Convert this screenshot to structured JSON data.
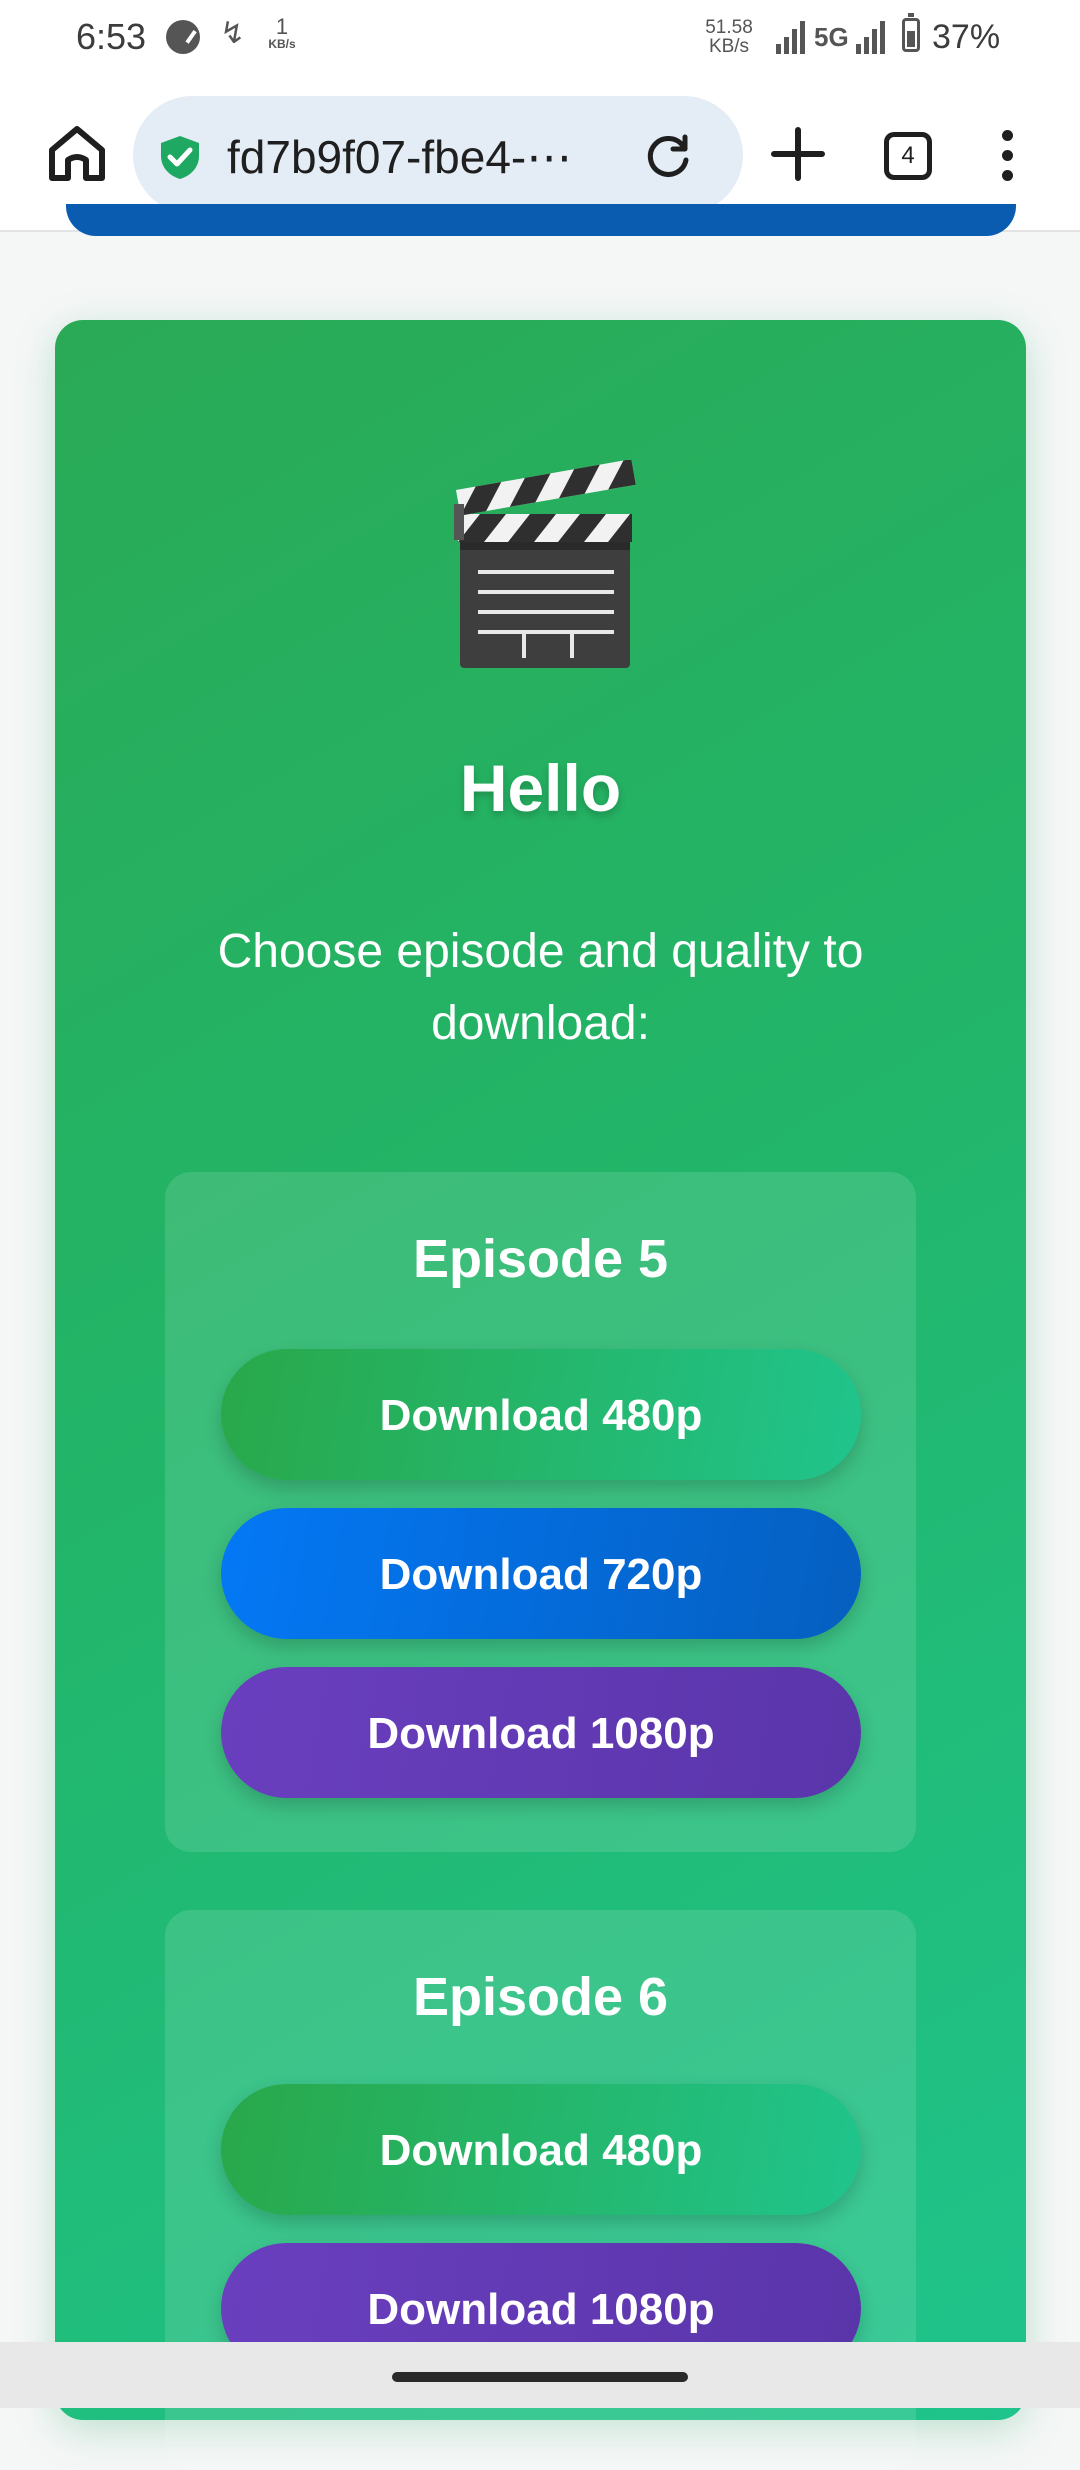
{
  "status_bar": {
    "time": "6:53",
    "speed_left_value": "1",
    "speed_left_unit": "KB/s",
    "speed_right_value": "51.58",
    "speed_right_unit": "KB/s",
    "network": "5G",
    "battery": "37%"
  },
  "browser": {
    "url": "fd7b9f07-fbe4-⋯",
    "tab_count": "4"
  },
  "page": {
    "heading": "Hello",
    "subtitle": "Choose episode and quality to download:",
    "episodes": [
      {
        "title": "Episode 5",
        "buttons": [
          "Download 480p",
          "Download 720p",
          "Download 1080p"
        ]
      },
      {
        "title": "Episode 6",
        "buttons": [
          "Download 480p",
          "Download 1080p"
        ]
      }
    ]
  },
  "colors": {
    "card_gradient_start": "#2aaa56",
    "card_gradient_end": "#1fc48c",
    "btn_480p": "#29a84a",
    "btn_720p": "#0478f5",
    "btn_1080p": "#6a3fbf"
  },
  "icons": [
    "shield-check-icon",
    "home-icon",
    "reload-icon",
    "plus-icon",
    "tabs-icon",
    "more-vert-icon",
    "clapperboard-icon"
  ]
}
